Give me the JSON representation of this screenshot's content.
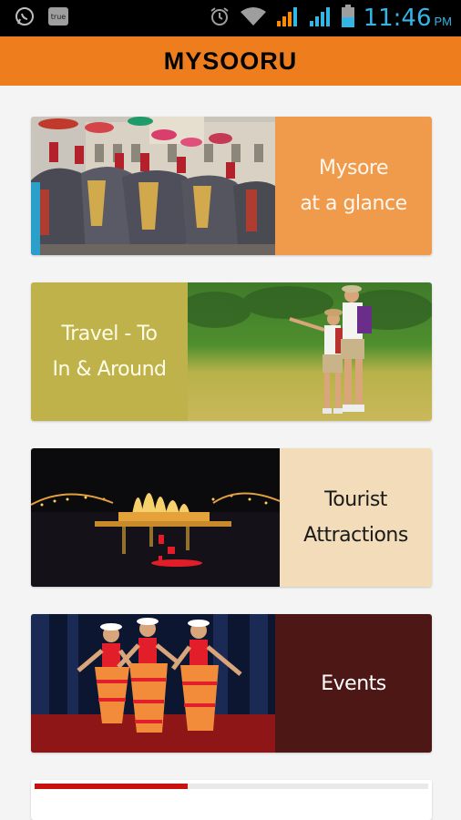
{
  "status_bar": {
    "time": "11:46",
    "time_suffix": "PM",
    "left_icons": [
      "whatsapp-icon",
      "true-app-icon"
    ],
    "true_badge": "true",
    "right_icons": [
      "alarm-icon",
      "wifi-icon",
      "signal-icon",
      "signal-icon",
      "battery-icon"
    ],
    "time_color": "#33b5e5"
  },
  "header": {
    "title": "MYSOORU",
    "background": "#ed7d1d"
  },
  "cards": [
    {
      "label": "Mysore\nat a glance",
      "label_bg": "#f09a4b",
      "photo": "palace-elephant-procession-photo"
    },
    {
      "label": "Travel - To\nIn & Around",
      "label_bg": "#bfb24a",
      "photo": "hikers-grassland-photo"
    },
    {
      "label": "Tourist\nAttractions",
      "label_bg": "#f3dcb9",
      "photo": "illuminated-fountain-night-photo"
    },
    {
      "label": "Events",
      "label_bg": "#4d1716",
      "photo": "classical-dancers-stage-photo"
    }
  ],
  "loading_progress": 0.39,
  "progress_color": "#c8120f"
}
